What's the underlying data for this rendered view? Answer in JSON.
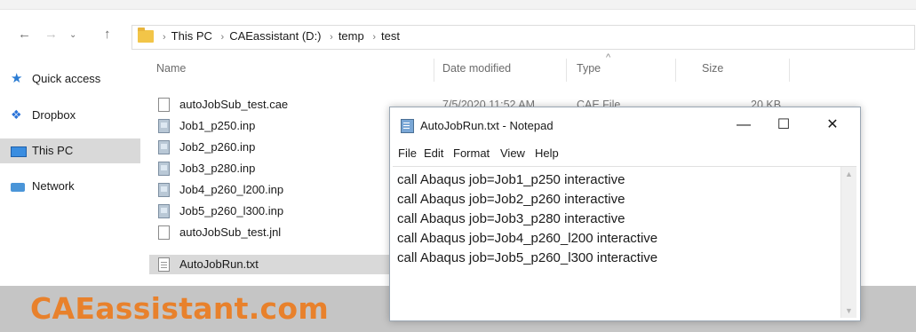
{
  "address": {
    "crumbs": [
      "This PC",
      "CAEassistant (D:)",
      "temp",
      "test"
    ]
  },
  "sidebar": {
    "items": [
      {
        "label": "Quick access",
        "icon": "star-icon"
      },
      {
        "label": "Dropbox",
        "icon": "dropbox-icon"
      },
      {
        "label": "This PC",
        "icon": "computer-icon",
        "selected": true
      },
      {
        "label": "Network",
        "icon": "network-icon"
      }
    ]
  },
  "columns": {
    "name": "Name",
    "date": "Date modified",
    "type": "Type",
    "size": "Size"
  },
  "files": [
    {
      "name": "autoJobSub_test.cae",
      "date": "7/5/2020 11:52 AM",
      "type": "CAE File",
      "size": "20 KB",
      "icon": "blank-file-icon"
    },
    {
      "name": "Job1_p250.inp",
      "icon": "inp-file-icon"
    },
    {
      "name": "Job2_p260.inp",
      "icon": "inp-file-icon"
    },
    {
      "name": "Job3_p280.inp",
      "icon": "inp-file-icon"
    },
    {
      "name": "Job4_p260_l200.inp",
      "icon": "inp-file-icon"
    },
    {
      "name": "Job5_p260_l300.inp",
      "icon": "inp-file-icon"
    },
    {
      "name": "autoJobSub_test.jnl",
      "icon": "blank-file-icon"
    },
    {
      "name": "AutoJobRun.txt",
      "icon": "text-file-icon",
      "selected": true
    }
  ],
  "notepad": {
    "title": "AutoJobRun.txt - Notepad",
    "menu": [
      "File",
      "Edit",
      "Format",
      "View",
      "Help"
    ],
    "lines": [
      "call Abaqus job=Job1_p250 interactive",
      "call Abaqus job=Job2_p260 interactive",
      "call Abaqus job=Job3_p280 interactive",
      "call Abaqus job=Job4_p260_l200 interactive",
      "call Abaqus job=Job5_p260_l300 interactive"
    ],
    "minimize": "—",
    "maximize": "☐",
    "close": "✕"
  },
  "watermark": "CAEassistant.com",
  "colors": {
    "accent": "#e8812c",
    "selection": "#d9d9d9"
  }
}
